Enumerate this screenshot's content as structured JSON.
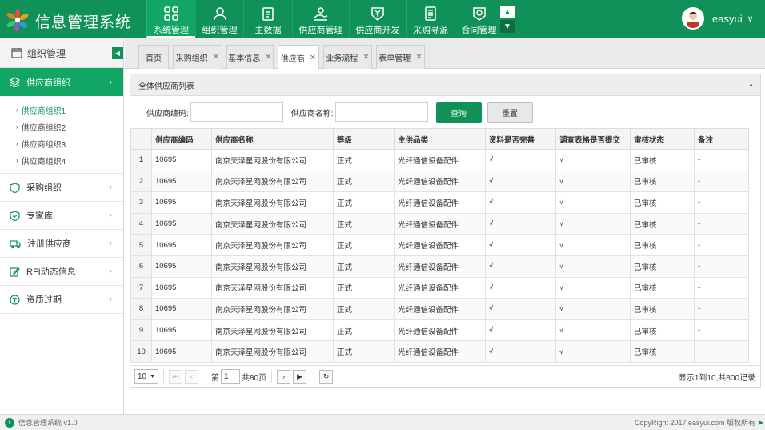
{
  "app": {
    "title": "信息管理系统"
  },
  "nav": [
    {
      "label": "系统管理",
      "icon": "grid-icon",
      "active": true
    },
    {
      "label": "组织管理",
      "icon": "user-icon"
    },
    {
      "label": "主数据",
      "icon": "clipboard-icon"
    },
    {
      "label": "供应商管理",
      "icon": "handshake-icon"
    },
    {
      "label": "供应商开发",
      "icon": "yen-shield-icon"
    },
    {
      "label": "采购寻源",
      "icon": "document-icon"
    },
    {
      "label": "合同管理",
      "icon": "contract-icon"
    }
  ],
  "user": {
    "name": "easyui"
  },
  "sidebar": {
    "header": "组织管理",
    "group": "供应商组织",
    "subitems": [
      "供应商组织1",
      "供应商组织2",
      "供应商组织3",
      "供应商组织4"
    ],
    "items": [
      {
        "label": "采购组织",
        "icon": "shield-icon"
      },
      {
        "label": "专家库",
        "icon": "badge-icon"
      },
      {
        "label": "注册供应商",
        "icon": "truck-icon"
      },
      {
        "label": "RFI动态信息",
        "icon": "edit-icon"
      },
      {
        "label": "资质过期",
        "icon": "certificate-icon"
      }
    ]
  },
  "tabs": [
    {
      "label": "首页",
      "closable": false
    },
    {
      "label": "采购组织",
      "closable": true
    },
    {
      "label": "基本信息",
      "closable": true
    },
    {
      "label": "供应商",
      "closable": true,
      "active": true
    },
    {
      "label": "业务流程",
      "closable": true
    },
    {
      "label": "表单管理",
      "closable": true
    }
  ],
  "panel": {
    "title": "全体供应商列表"
  },
  "search": {
    "code_label": "供应商编码:",
    "name_label": "供应商名称:",
    "query_button": "查询",
    "reset_button": "重置"
  },
  "table": {
    "columns": [
      "供应商编码",
      "供应商名称",
      "等级",
      "主供品类",
      "资料是否完善",
      "调查表格是否提交",
      "审核状态",
      "备注"
    ],
    "rows": [
      [
        "1",
        "10695",
        "南京天泽星网股份有限公司",
        "正式",
        "光纤通信设备配件",
        "√",
        "√",
        "已审核",
        "-"
      ],
      [
        "2",
        "10695",
        "南京天泽星网股份有限公司",
        "正式",
        "光纤通信设备配件",
        "√",
        "√",
        "已审核",
        "-"
      ],
      [
        "3",
        "10695",
        "南京天泽星网股份有限公司",
        "正式",
        "光纤通信设备配件",
        "√",
        "√",
        "已审核",
        "-"
      ],
      [
        "4",
        "10695",
        "南京天泽星网股份有限公司",
        "正式",
        "光纤通信设备配件",
        "√",
        "√",
        "已审核",
        "-"
      ],
      [
        "5",
        "10695",
        "南京天泽星网股份有限公司",
        "正式",
        "光纤通信设备配件",
        "√",
        "√",
        "已审核",
        "-"
      ],
      [
        "6",
        "10695",
        "南京天泽星网股份有限公司",
        "正式",
        "光纤通信设备配件",
        "√",
        "√",
        "已审核",
        "-"
      ],
      [
        "7",
        "10695",
        "南京天泽星网股份有限公司",
        "正式",
        "光纤通信设备配件",
        "√",
        "√",
        "已审核",
        "-"
      ],
      [
        "8",
        "10695",
        "南京天泽星网股份有限公司",
        "正式",
        "光纤通信设备配件",
        "√",
        "√",
        "已审核",
        "-"
      ],
      [
        "9",
        "10695",
        "南京天泽星网股份有限公司",
        "正式",
        "光纤通信设备配件",
        "√",
        "√",
        "已审核",
        "-"
      ],
      [
        "10",
        "10695",
        "南京天泽星网股份有限公司",
        "正式",
        "光纤通信设备配件",
        "√",
        "√",
        "已审核",
        "-"
      ]
    ]
  },
  "pager": {
    "page_size": "10",
    "page_prefix": "第",
    "page": "1",
    "page_suffix": "共80页",
    "info": "显示1到10,共800记录"
  },
  "footer": {
    "version": "信息管理系统 v1.0",
    "copyright": "CopyRight 2017  easyui.com 版权所有"
  },
  "colors": {
    "primary": "#0f9157",
    "primary_light": "#11a664"
  }
}
